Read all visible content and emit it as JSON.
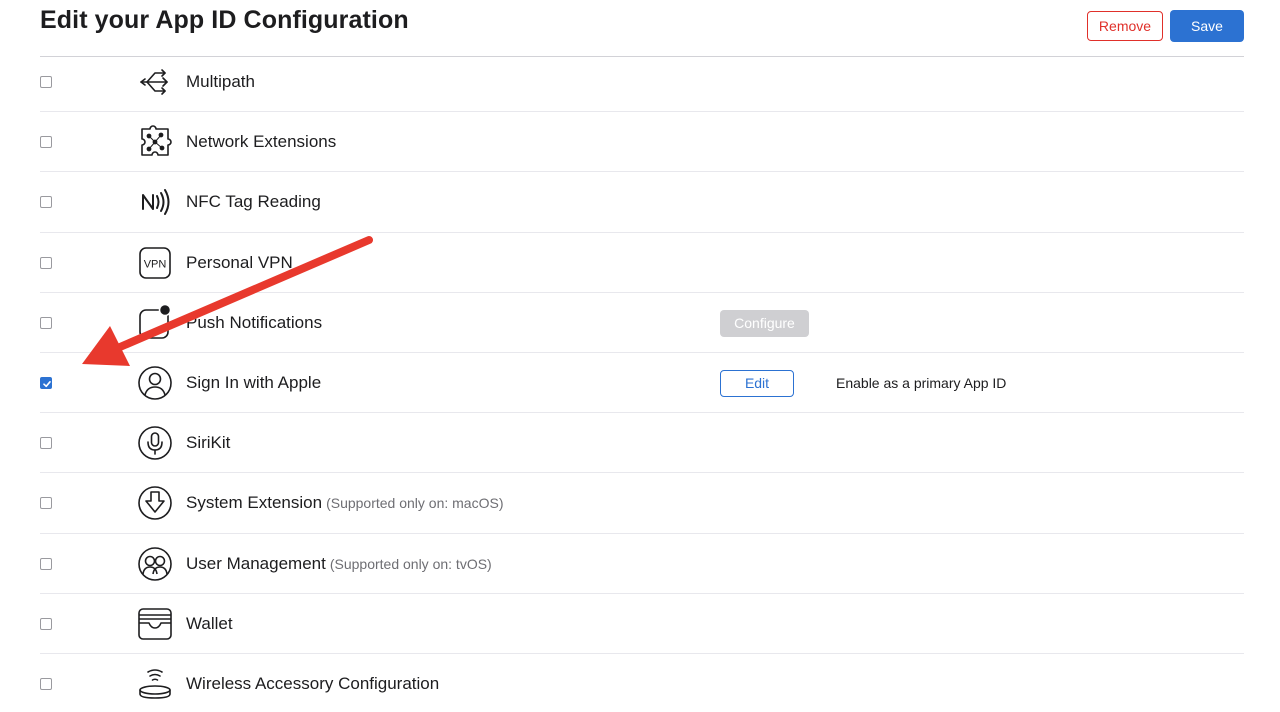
{
  "page": {
    "title": "Edit your App ID Configuration",
    "remove_label": "Remove",
    "save_label": "Save"
  },
  "capabilities": [
    {
      "name": "Multipath",
      "icon": "multipath-icon",
      "checked": false
    },
    {
      "name": "Network Extensions",
      "icon": "network-extensions-icon",
      "checked": false
    },
    {
      "name": "NFC Tag Reading",
      "icon": "nfc-icon",
      "checked": false
    },
    {
      "name": "Personal VPN",
      "icon": "vpn-icon",
      "checked": false,
      "icon_text": "VPN"
    },
    {
      "name": "Push Notifications",
      "icon": "push-notifications-icon",
      "checked": false,
      "button": "Configure"
    },
    {
      "name": "Sign In with Apple",
      "icon": "sign-in-with-apple-icon",
      "checked": true,
      "button": "Edit",
      "extra": "Enable as a primary App ID"
    },
    {
      "name": "SiriKit",
      "icon": "sirikit-icon",
      "checked": false
    },
    {
      "name": "System Extension",
      "icon": "system-extension-icon",
      "checked": false,
      "note": "(Supported only on: macOS)"
    },
    {
      "name": "User Management",
      "icon": "user-management-icon",
      "checked": false,
      "note": "(Supported only on: tvOS)"
    },
    {
      "name": "Wallet",
      "icon": "wallet-icon",
      "checked": false
    },
    {
      "name": "Wireless Accessory Configuration",
      "icon": "wireless-accessory-icon",
      "checked": false
    }
  ],
  "colors": {
    "accent": "#2c72d2",
    "danger": "#e0302a",
    "annotation_arrow": "#e8392d"
  }
}
